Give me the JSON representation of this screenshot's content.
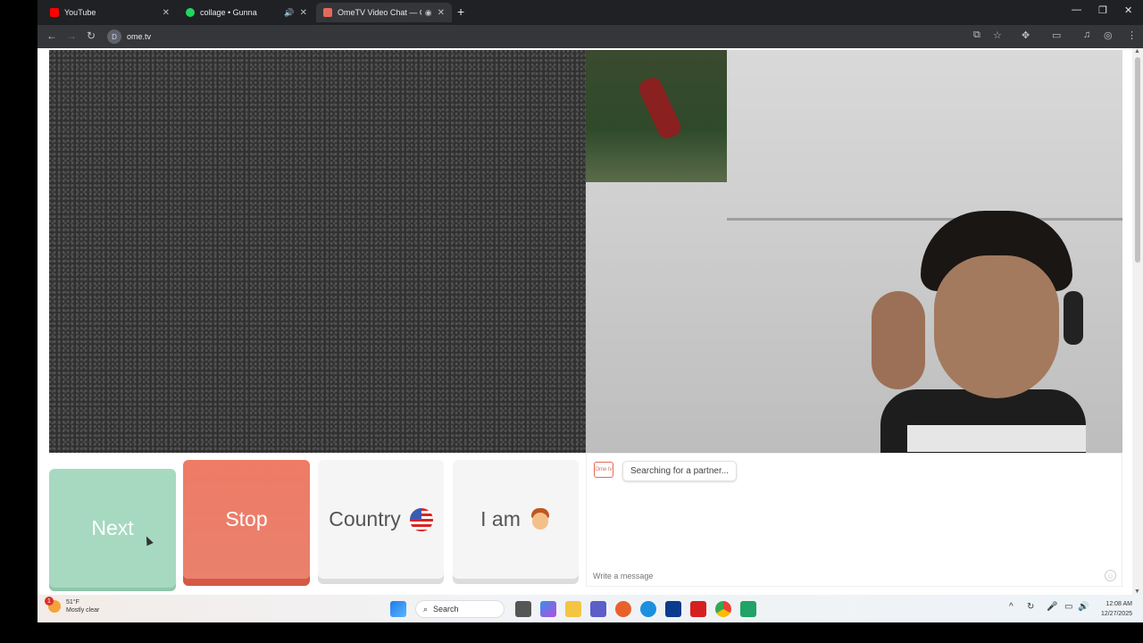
{
  "browser": {
    "tabs": [
      {
        "title": "YouTube",
        "favicon_color": "#ff0000"
      },
      {
        "title": "collage • Gunna",
        "favicon_color": "#1ed760"
      },
      {
        "title": "OmeTV Video Chat — Ome",
        "favicon_color": "#e36a5b"
      }
    ],
    "new_tab": "+",
    "url": "ome.tv",
    "site_icon": "D"
  },
  "controls": {
    "next_label": "Next",
    "stop_label": "Stop",
    "country_label": "Country",
    "iam_label": "I am"
  },
  "chat": {
    "logo_text": "Ome tv",
    "status_message": "Searching for a partner...",
    "input_placeholder": "Write a message"
  },
  "taskbar": {
    "weather_temp": "51°F",
    "weather_desc": "Mostly clear",
    "weather_badge": "1",
    "search_label": "Search",
    "time": "12:08 AM",
    "date": "12/27/2025"
  },
  "colors": {
    "next_button": "#a6d9c0",
    "stop_button": "#ee7b66",
    "neutral_button": "#f5f5f5",
    "brand": "#e36a5b"
  }
}
